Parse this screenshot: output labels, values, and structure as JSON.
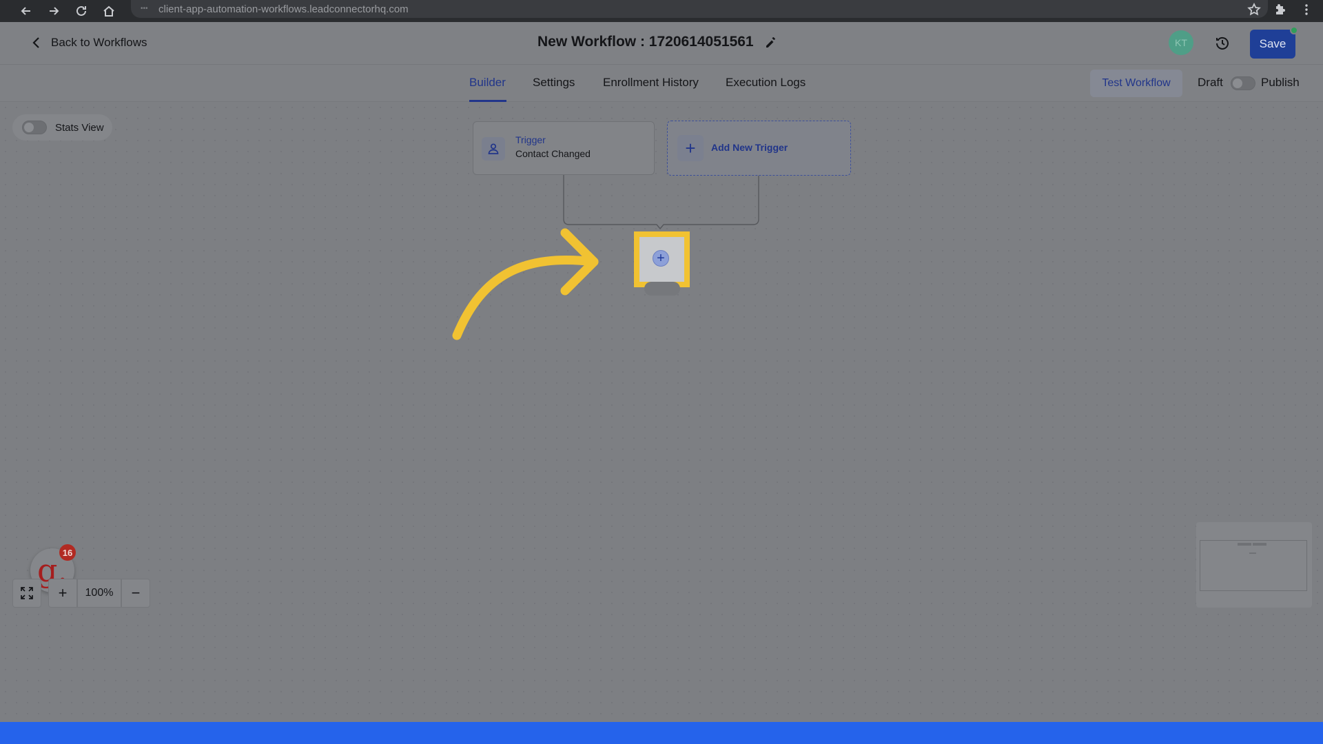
{
  "browser": {
    "url": "client-app-automation-workflows.leadconnectorhq.com"
  },
  "header": {
    "back_label": "Back to Workflows",
    "workflow_title": "New Workflow : 1720614051561",
    "avatar_initials": "KT",
    "save_label": "Save"
  },
  "tabs": [
    {
      "label": "Builder",
      "active": true
    },
    {
      "label": "Settings",
      "active": false
    },
    {
      "label": "Enrollment History",
      "active": false
    },
    {
      "label": "Execution Logs",
      "active": false
    }
  ],
  "actions": {
    "test_label": "Test Workflow",
    "draft_label": "Draft",
    "publish_label": "Publish",
    "publish_enabled": false
  },
  "canvas": {
    "stats_view_label": "Stats View",
    "stats_view_enabled": false,
    "trigger": {
      "title": "Trigger",
      "subtitle": "Contact Changed"
    },
    "add_trigger_label": "Add New Trigger",
    "highlight_color": "#f1c232"
  },
  "zoom": {
    "level": "100%"
  },
  "guide_badge": {
    "letter": "g.",
    "count": "16"
  },
  "colors": {
    "accent": "#21358a",
    "save_button": "#1f3f97",
    "avatar": "#4f9e87",
    "badge": "#b12a22"
  }
}
